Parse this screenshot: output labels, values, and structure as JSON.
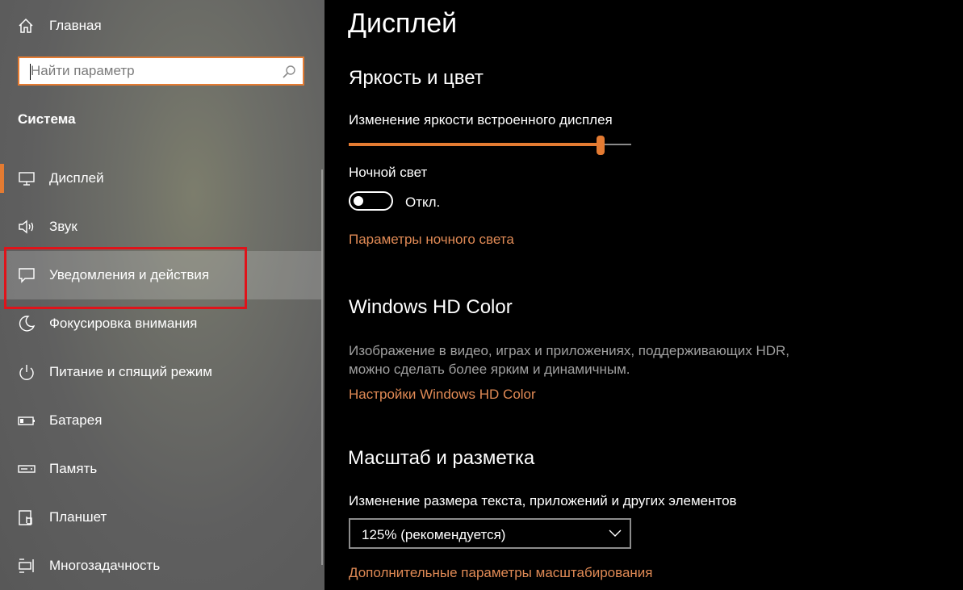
{
  "sidebar": {
    "home_label": "Главная",
    "search": {
      "placeholder": "Найти параметр",
      "value": ""
    },
    "section_title": "Система",
    "items": [
      {
        "label": "Дисплей",
        "icon": "monitor-icon",
        "active": true
      },
      {
        "label": "Звук",
        "icon": "speaker-icon"
      },
      {
        "label": "Уведомления и действия",
        "icon": "notification-icon",
        "highlighted": true
      },
      {
        "label": "Фокусировка внимания",
        "icon": "moon-icon"
      },
      {
        "label": "Питание и спящий режим",
        "icon": "power-icon"
      },
      {
        "label": "Батарея",
        "icon": "battery-icon"
      },
      {
        "label": "Память",
        "icon": "storage-icon"
      },
      {
        "label": "Планшет",
        "icon": "tablet-icon"
      },
      {
        "label": "Многозадачность",
        "icon": "multitasking-icon"
      }
    ]
  },
  "main": {
    "title": "Дисплей",
    "brightness": {
      "heading": "Яркость и цвет",
      "slider_label": "Изменение яркости встроенного дисплея",
      "slider_value_fraction": 0.89,
      "night_light_label": "Ночной свет",
      "night_light_state": "Откл.",
      "night_light_link": "Параметры ночного света"
    },
    "hdr": {
      "heading": "Windows HD Color",
      "description": "Изображение в видео, играх и приложениях, поддерживающих HDR, можно сделать более ярким и динамичным.",
      "link": "Настройки Windows HD Color"
    },
    "scale": {
      "heading": "Масштаб и разметка",
      "label": "Изменение размера текста, приложений и других элементов",
      "selected": "125% (рекомендуется)",
      "link": "Дополнительные параметры масштабирования"
    }
  },
  "colors": {
    "accent": "#e47b32",
    "link": "#e08a55",
    "highlight_box": "#e0131a"
  }
}
